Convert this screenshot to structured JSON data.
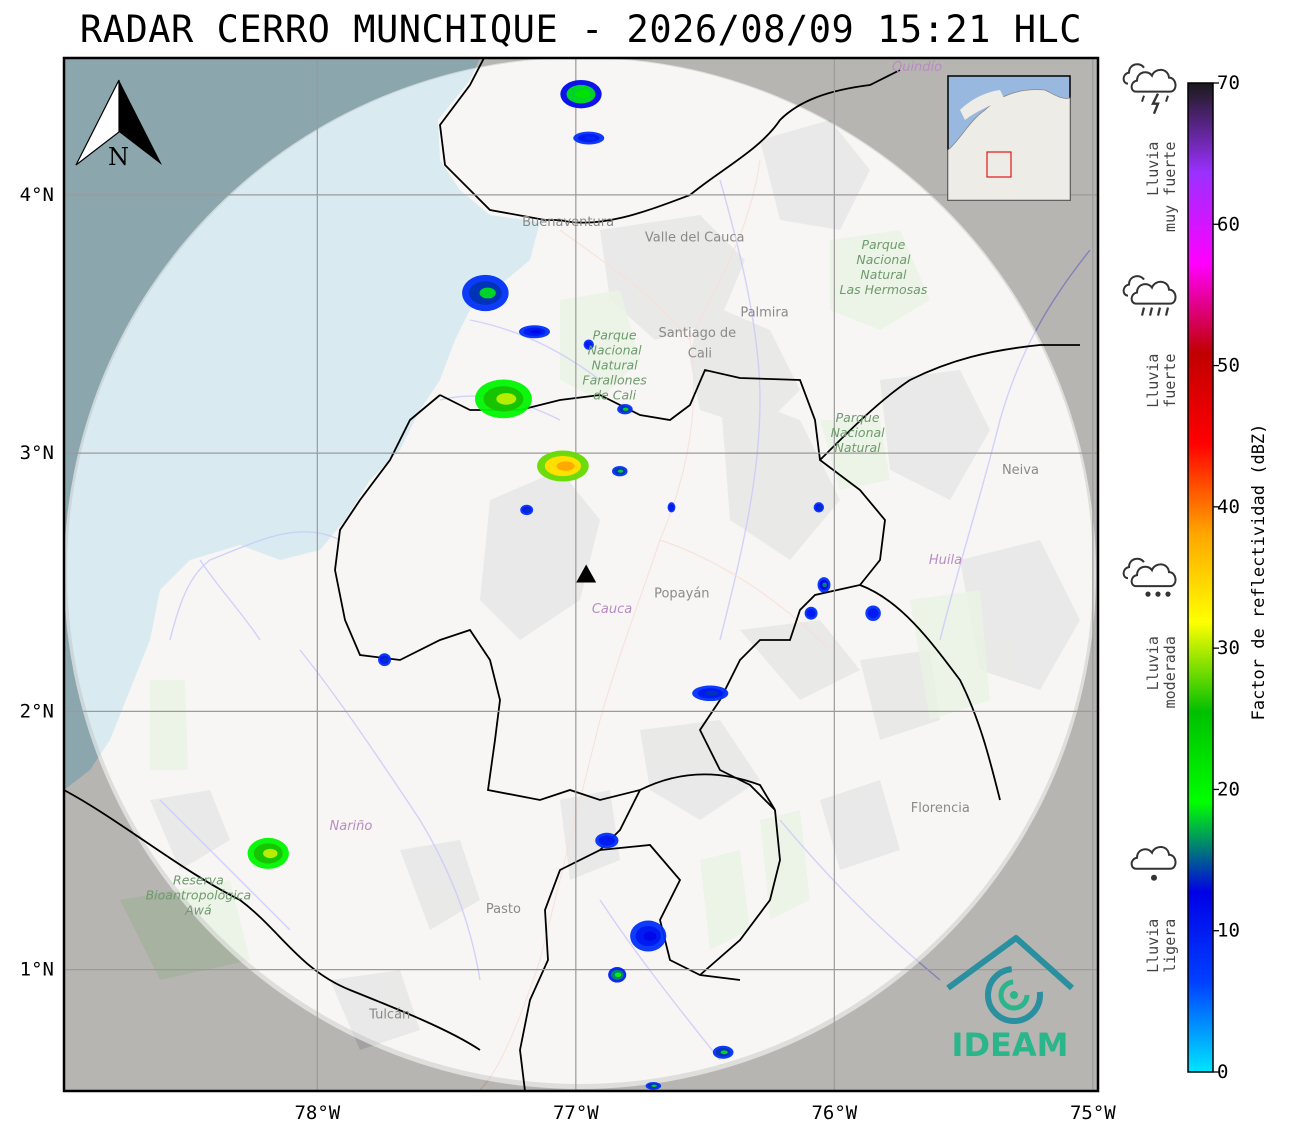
{
  "title": "RADAR CERRO MUNCHIQUE - 2026/08/09 15:21 HLC",
  "map": {
    "lat_range": [
      0.53,
      4.53
    ],
    "lon_range": [
      -78.98,
      -74.98
    ],
    "radar_site": {
      "lat": 2.53,
      "lon": -76.96
    },
    "lat_ticks": [
      "1°N",
      "2°N",
      "3°N",
      "4°N"
    ],
    "lon_ticks": [
      "78°W",
      "77°W",
      "76°W",
      "75°W"
    ],
    "north_arrow_label": "N",
    "places": [
      {
        "name": "Buenaventura",
        "lat": 3.88,
        "lon": -77.03
      },
      {
        "name": "Valle del Cauca",
        "lat": 3.82,
        "lon": -76.54
      },
      {
        "name": "Palmira",
        "lat": 3.53,
        "lon": -76.27
      },
      {
        "name": "Santiago de",
        "lat": 3.45,
        "lon": -76.53
      },
      {
        "name": "Cali",
        "lat": 3.37,
        "lon": -76.52
      },
      {
        "name": "Popayán",
        "lat": 2.44,
        "lon": -76.59
      },
      {
        "name": "Cauca",
        "lat": 2.38,
        "lon": -76.86
      },
      {
        "name": "Neiva",
        "lat": 2.92,
        "lon": -75.28
      },
      {
        "name": "Huila",
        "lat": 2.57,
        "lon": -75.57
      },
      {
        "name": "Nariño",
        "lat": 1.54,
        "lon": -77.87
      },
      {
        "name": "Pasto",
        "lat": 1.22,
        "lon": -77.28
      },
      {
        "name": "Florencia",
        "lat": 1.61,
        "lon": -75.59
      },
      {
        "name": "Tulcán",
        "lat": 0.81,
        "lon": -77.72
      },
      {
        "name": "Quindío",
        "lat": 4.48,
        "lon": -75.68
      }
    ],
    "parks": [
      {
        "lines": [
          "Parque",
          "Nacional",
          "Natural",
          "Las Hermosas"
        ],
        "lat": 3.79,
        "lon": -75.81
      },
      {
        "lines": [
          "Parque",
          "Nacional",
          "Natural",
          "Farallones",
          "de Cali"
        ],
        "lat": 3.44,
        "lon": -76.85
      },
      {
        "lines": [
          "Parque",
          "Nacional",
          "Natural"
        ],
        "lat": 3.12,
        "lon": -75.91
      },
      {
        "lines": [
          "Reserva",
          "Bioantropológica",
          "Awá"
        ],
        "lat": 1.33,
        "lon": -78.46
      }
    ],
    "logo_text": "IDEAM"
  },
  "colorbar": {
    "title": "Factor de reflectividad (dBZ)",
    "min": 0,
    "max": 70,
    "ticks": [
      "0",
      "10",
      "20",
      "30",
      "40",
      "50",
      "60",
      "70"
    ],
    "stops": [
      "#00e5ff",
      "#0040ff",
      "#0000e6",
      "#00ff00",
      "#00c000",
      "#ffff00",
      "#ffa500",
      "#ff0000",
      "#c00000",
      "#ff00ff",
      "#9b30ff",
      "#1a1a1a"
    ]
  },
  "legend": [
    {
      "line1": "Lluvia",
      "line2": "muy fuerte",
      "dbz": 65
    },
    {
      "line1": "Lluvia",
      "line2": "fuerte",
      "dbz": 50
    },
    {
      "line1": "Lluvia",
      "line2": "moderada",
      "dbz": 30
    },
    {
      "line1": "Lluvia",
      "line2": "ligera",
      "dbz": 10
    }
  ],
  "echoes": [
    {
      "lat": 4.39,
      "lon": -76.98,
      "dbz": 22,
      "w": 0.16,
      "h": 0.11
    },
    {
      "lat": 4.22,
      "lon": -76.95,
      "dbz": 9,
      "w": 0.12,
      "h": 0.05
    },
    {
      "lat": 3.62,
      "lon": -77.35,
      "dbz": 18,
      "w": 0.18,
      "h": 0.14
    },
    {
      "lat": 3.47,
      "lon": -77.16,
      "dbz": 12,
      "w": 0.12,
      "h": 0.05
    },
    {
      "lat": 3.42,
      "lon": -76.95,
      "dbz": 10,
      "w": 0.04,
      "h": 0.04
    },
    {
      "lat": 3.21,
      "lon": -77.28,
      "dbz": 30,
      "w": 0.22,
      "h": 0.15
    },
    {
      "lat": 3.17,
      "lon": -76.81,
      "dbz": 18,
      "w": 0.06,
      "h": 0.04
    },
    {
      "lat": 2.95,
      "lon": -77.05,
      "dbz": 38,
      "w": 0.2,
      "h": 0.12
    },
    {
      "lat": 2.93,
      "lon": -76.83,
      "dbz": 18,
      "w": 0.06,
      "h": 0.04
    },
    {
      "lat": 2.78,
      "lon": -77.19,
      "dbz": 14,
      "w": 0.05,
      "h": 0.04
    },
    {
      "lat": 2.79,
      "lon": -76.63,
      "dbz": 10,
      "w": 0.03,
      "h": 0.04
    },
    {
      "lat": 2.79,
      "lon": -76.06,
      "dbz": 14,
      "w": 0.04,
      "h": 0.04
    },
    {
      "lat": 2.49,
      "lon": -76.04,
      "dbz": 16,
      "w": 0.05,
      "h": 0.06
    },
    {
      "lat": 2.38,
      "lon": -76.09,
      "dbz": 10,
      "w": 0.05,
      "h": 0.05
    },
    {
      "lat": 2.38,
      "lon": -75.85,
      "dbz": 10,
      "w": 0.06,
      "h": 0.06
    },
    {
      "lat": 2.2,
      "lon": -77.74,
      "dbz": 14,
      "w": 0.05,
      "h": 0.05
    },
    {
      "lat": 2.07,
      "lon": -76.48,
      "dbz": 14,
      "w": 0.14,
      "h": 0.06
    },
    {
      "lat": 1.5,
      "lon": -76.88,
      "dbz": 10,
      "w": 0.09,
      "h": 0.06
    },
    {
      "lat": 1.45,
      "lon": -78.19,
      "dbz": 30,
      "w": 0.16,
      "h": 0.12
    },
    {
      "lat": 1.13,
      "lon": -76.72,
      "dbz": 12,
      "w": 0.14,
      "h": 0.12
    },
    {
      "lat": 0.98,
      "lon": -76.84,
      "dbz": 20,
      "w": 0.07,
      "h": 0.06
    },
    {
      "lat": 0.68,
      "lon": -76.43,
      "dbz": 18,
      "w": 0.08,
      "h": 0.05
    },
    {
      "lat": 0.55,
      "lon": -76.7,
      "dbz": 18,
      "w": 0.06,
      "h": 0.03
    }
  ]
}
